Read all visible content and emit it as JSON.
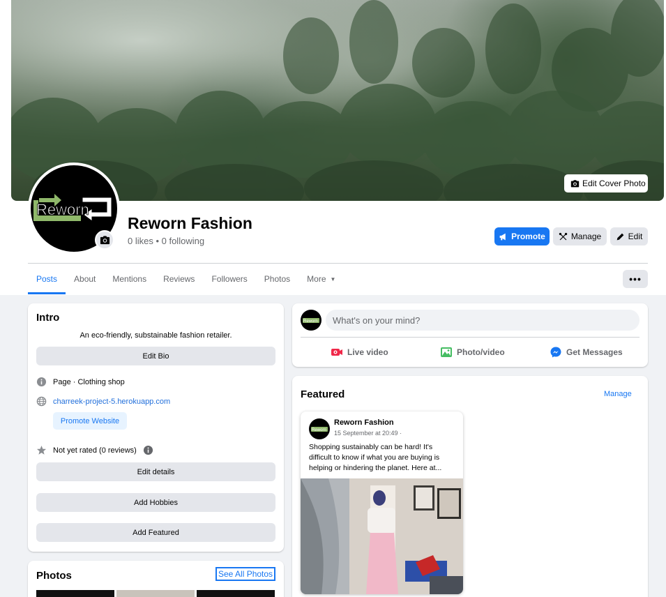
{
  "cover": {
    "edit_label": "Edit Cover Photo"
  },
  "profile": {
    "logo_text": "Reworn",
    "name": "Reworn Fashion",
    "stats": "0 likes • 0 following"
  },
  "actions": {
    "promote": "Promote",
    "manage": "Manage",
    "edit": "Edit"
  },
  "tabs": [
    {
      "label": "Posts",
      "active": true
    },
    {
      "label": "About"
    },
    {
      "label": "Mentions"
    },
    {
      "label": "Reviews"
    },
    {
      "label": "Followers"
    },
    {
      "label": "Photos"
    },
    {
      "label": "More"
    }
  ],
  "more_menu": "•••",
  "intro": {
    "title": "Intro",
    "bio": "An eco-friendly, substainable fashion retailer.",
    "edit_bio": "Edit Bio",
    "category": "Page · Clothing shop",
    "website": "charreek-project-5.herokuapp.com",
    "promote_website": "Promote Website",
    "rating": "Not yet rated (0 reviews)",
    "edit_details": "Edit details",
    "add_hobbies": "Add Hobbies",
    "add_featured": "Add Featured"
  },
  "photos": {
    "title": "Photos",
    "see_all": "See All Photos"
  },
  "composer": {
    "placeholder": "What's on your mind?",
    "live_video": "Live video",
    "photo_video": "Photo/video",
    "get_messages": "Get Messages"
  },
  "featured": {
    "title": "Featured",
    "manage": "Manage",
    "post": {
      "author": "Reworn Fashion",
      "time": "15 September at 20:49 ·",
      "text": "Shopping sustainably can be hard! It's difficult to know if what you are buying is helping or hindering the planet. Here at..."
    }
  },
  "colors": {
    "accent": "#1877f2",
    "logo_green": "#8fb86a",
    "page_bg": "#f0f2f5"
  }
}
